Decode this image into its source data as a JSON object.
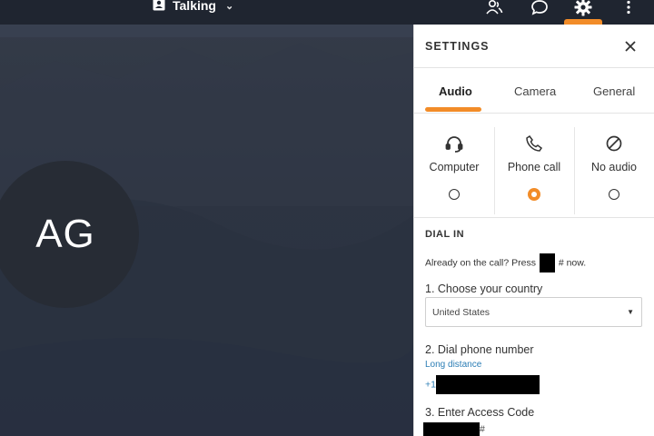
{
  "topbar": {
    "talking_label": "Talking",
    "icons": [
      "participants-icon",
      "chat-icon",
      "gear-icon",
      "more-vertical-icon"
    ]
  },
  "stage": {
    "avatar_initials": "AG"
  },
  "settings": {
    "title": "SETTINGS",
    "tabs": [
      {
        "label": "Audio",
        "active": true
      },
      {
        "label": "Camera",
        "active": false
      },
      {
        "label": "General",
        "active": false
      }
    ],
    "audio_options": [
      {
        "label": "Computer",
        "icon": "headset-icon",
        "selected": false
      },
      {
        "label": "Phone call",
        "icon": "phone-icon",
        "selected": true
      },
      {
        "label": "No audio",
        "icon": "no-audio-icon",
        "selected": false
      }
    ],
    "dial_in": {
      "title": "DIAL IN",
      "already_prefix": "Already on the call? Press",
      "already_suffix": "# now.",
      "step1": "1. Choose your country",
      "country_value": "United States",
      "step2": "2. Dial phone number",
      "long_distance": "Long distance",
      "phone_prefix": "+1",
      "step3": "3. Enter Access Code",
      "code_suffix": "#"
    }
  },
  "colors": {
    "accent": "#f28c28",
    "link": "#2b7db5",
    "topbar": "#1f2530",
    "stage": "#2f3542"
  }
}
